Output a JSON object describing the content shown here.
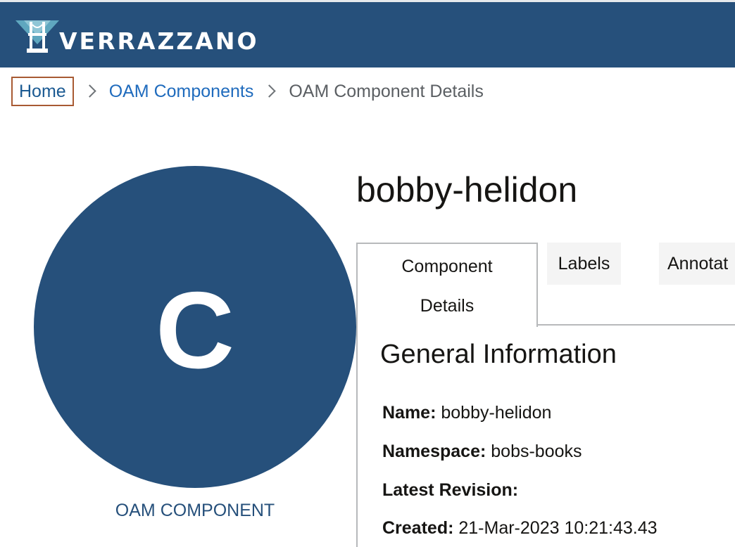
{
  "header": {
    "brand": "VERRAZZANO"
  },
  "breadcrumb": {
    "home": "Home",
    "components": "OAM Components",
    "current": "OAM Component Details"
  },
  "component": {
    "name": "bobby-helidon",
    "avatar_letter": "C",
    "avatar_caption": "OAM COMPONENT"
  },
  "tabs": {
    "details_line1": "Component",
    "details_line2": "Details",
    "labels": "Labels",
    "annotations": "Annotat"
  },
  "general_info": {
    "title": "General Information",
    "fields": [
      {
        "label": "Name:",
        "value": "bobby-helidon"
      },
      {
        "label": "Namespace:",
        "value": "bobs-books"
      },
      {
        "label": "Latest Revision:",
        "value": ""
      },
      {
        "label": "Created:",
        "value": "21-Mar-2023 10:21:43.43"
      }
    ]
  },
  "colors": {
    "brand_blue": "#26507b",
    "link_blue": "#1f6bbd",
    "focus_border": "#a85a33"
  },
  "icons": {
    "logo": "verrazzano-bridge-logo-icon",
    "separator": "chevron-right-icon"
  }
}
